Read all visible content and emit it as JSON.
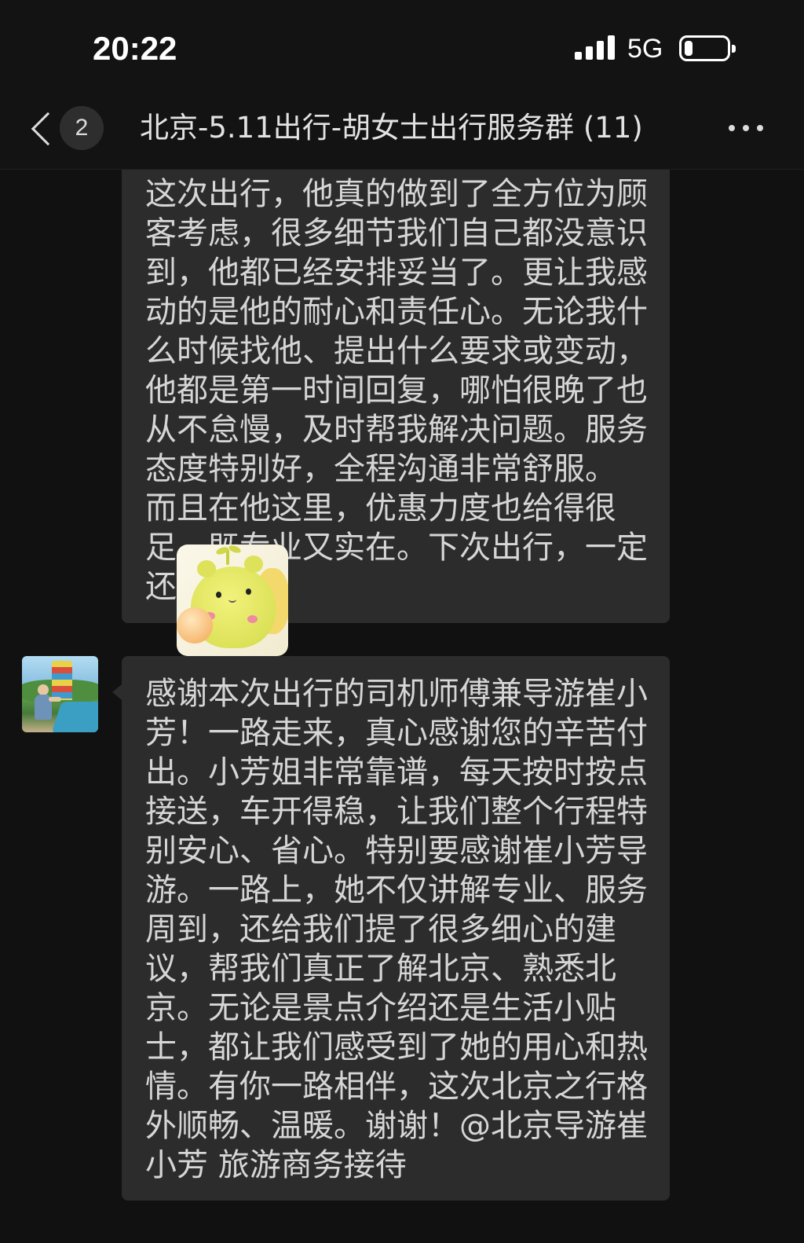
{
  "status_bar": {
    "time": "20:22",
    "network": "5G",
    "signal_icon": "signal-bars-icon",
    "battery_icon": "battery-icon",
    "battery_level_percent": 20
  },
  "nav": {
    "back_icon": "chevron-left-icon",
    "unread_count": "2",
    "title": "北京-5.11出行-胡女士出行服务群 (11)",
    "more_icon": "more-dots-icon"
  },
  "messages": [
    {
      "lines": [
        "这次出行，他真的做到了全方位为顾",
        "客考虑，很多细节我们自己都没意识",
        "到，他都已经安排妥当了。更让我感",
        "动的是他的耐心和责任心。无论我什",
        "么时候找他、提出什么要求或变动，",
        "他都是第一时间回复，哪怕很晚了也",
        "从不怠慢，及时帮我解决问题。服务",
        "态度特别好，全程沟通非常舒服。",
        "而且在他这里，优惠力度也给得很",
        "足，既专业又实在。下次出行，一定",
        "还"
      ]
    },
    {
      "avatar_icon": "playground-photo-avatar",
      "lines": [
        "感谢本次出行的司机师傅兼导游崔小",
        "芳！一路走来，真心感谢您的辛苦付",
        "出。小芳姐非常靠谱，每天按时按点",
        "接送，车开得稳，让我们整个行程特",
        "别安心、省心。特别要感谢崔小芳导",
        "游。一路上，她不仅讲解专业、服务",
        "周到，还给我们提了很多细心的建",
        "议，帮我们真正了解北京、熟悉北",
        "京。无论是景点介绍还是生活小贴",
        "士，都让我们感受到了她的用心和热",
        "情。有你一路相伴，这次北京之行格",
        "外顺畅、温暖。谢谢！@北京导游崔",
        "小芳 旅游商务接待"
      ]
    }
  ],
  "sticker": {
    "icon": "yellow-bear-sticker"
  },
  "colors": {
    "background": "#111111",
    "header": "#131313",
    "bubble": "#2c2c2c",
    "text": "#d6d6d6",
    "accent": "#ffffff"
  }
}
